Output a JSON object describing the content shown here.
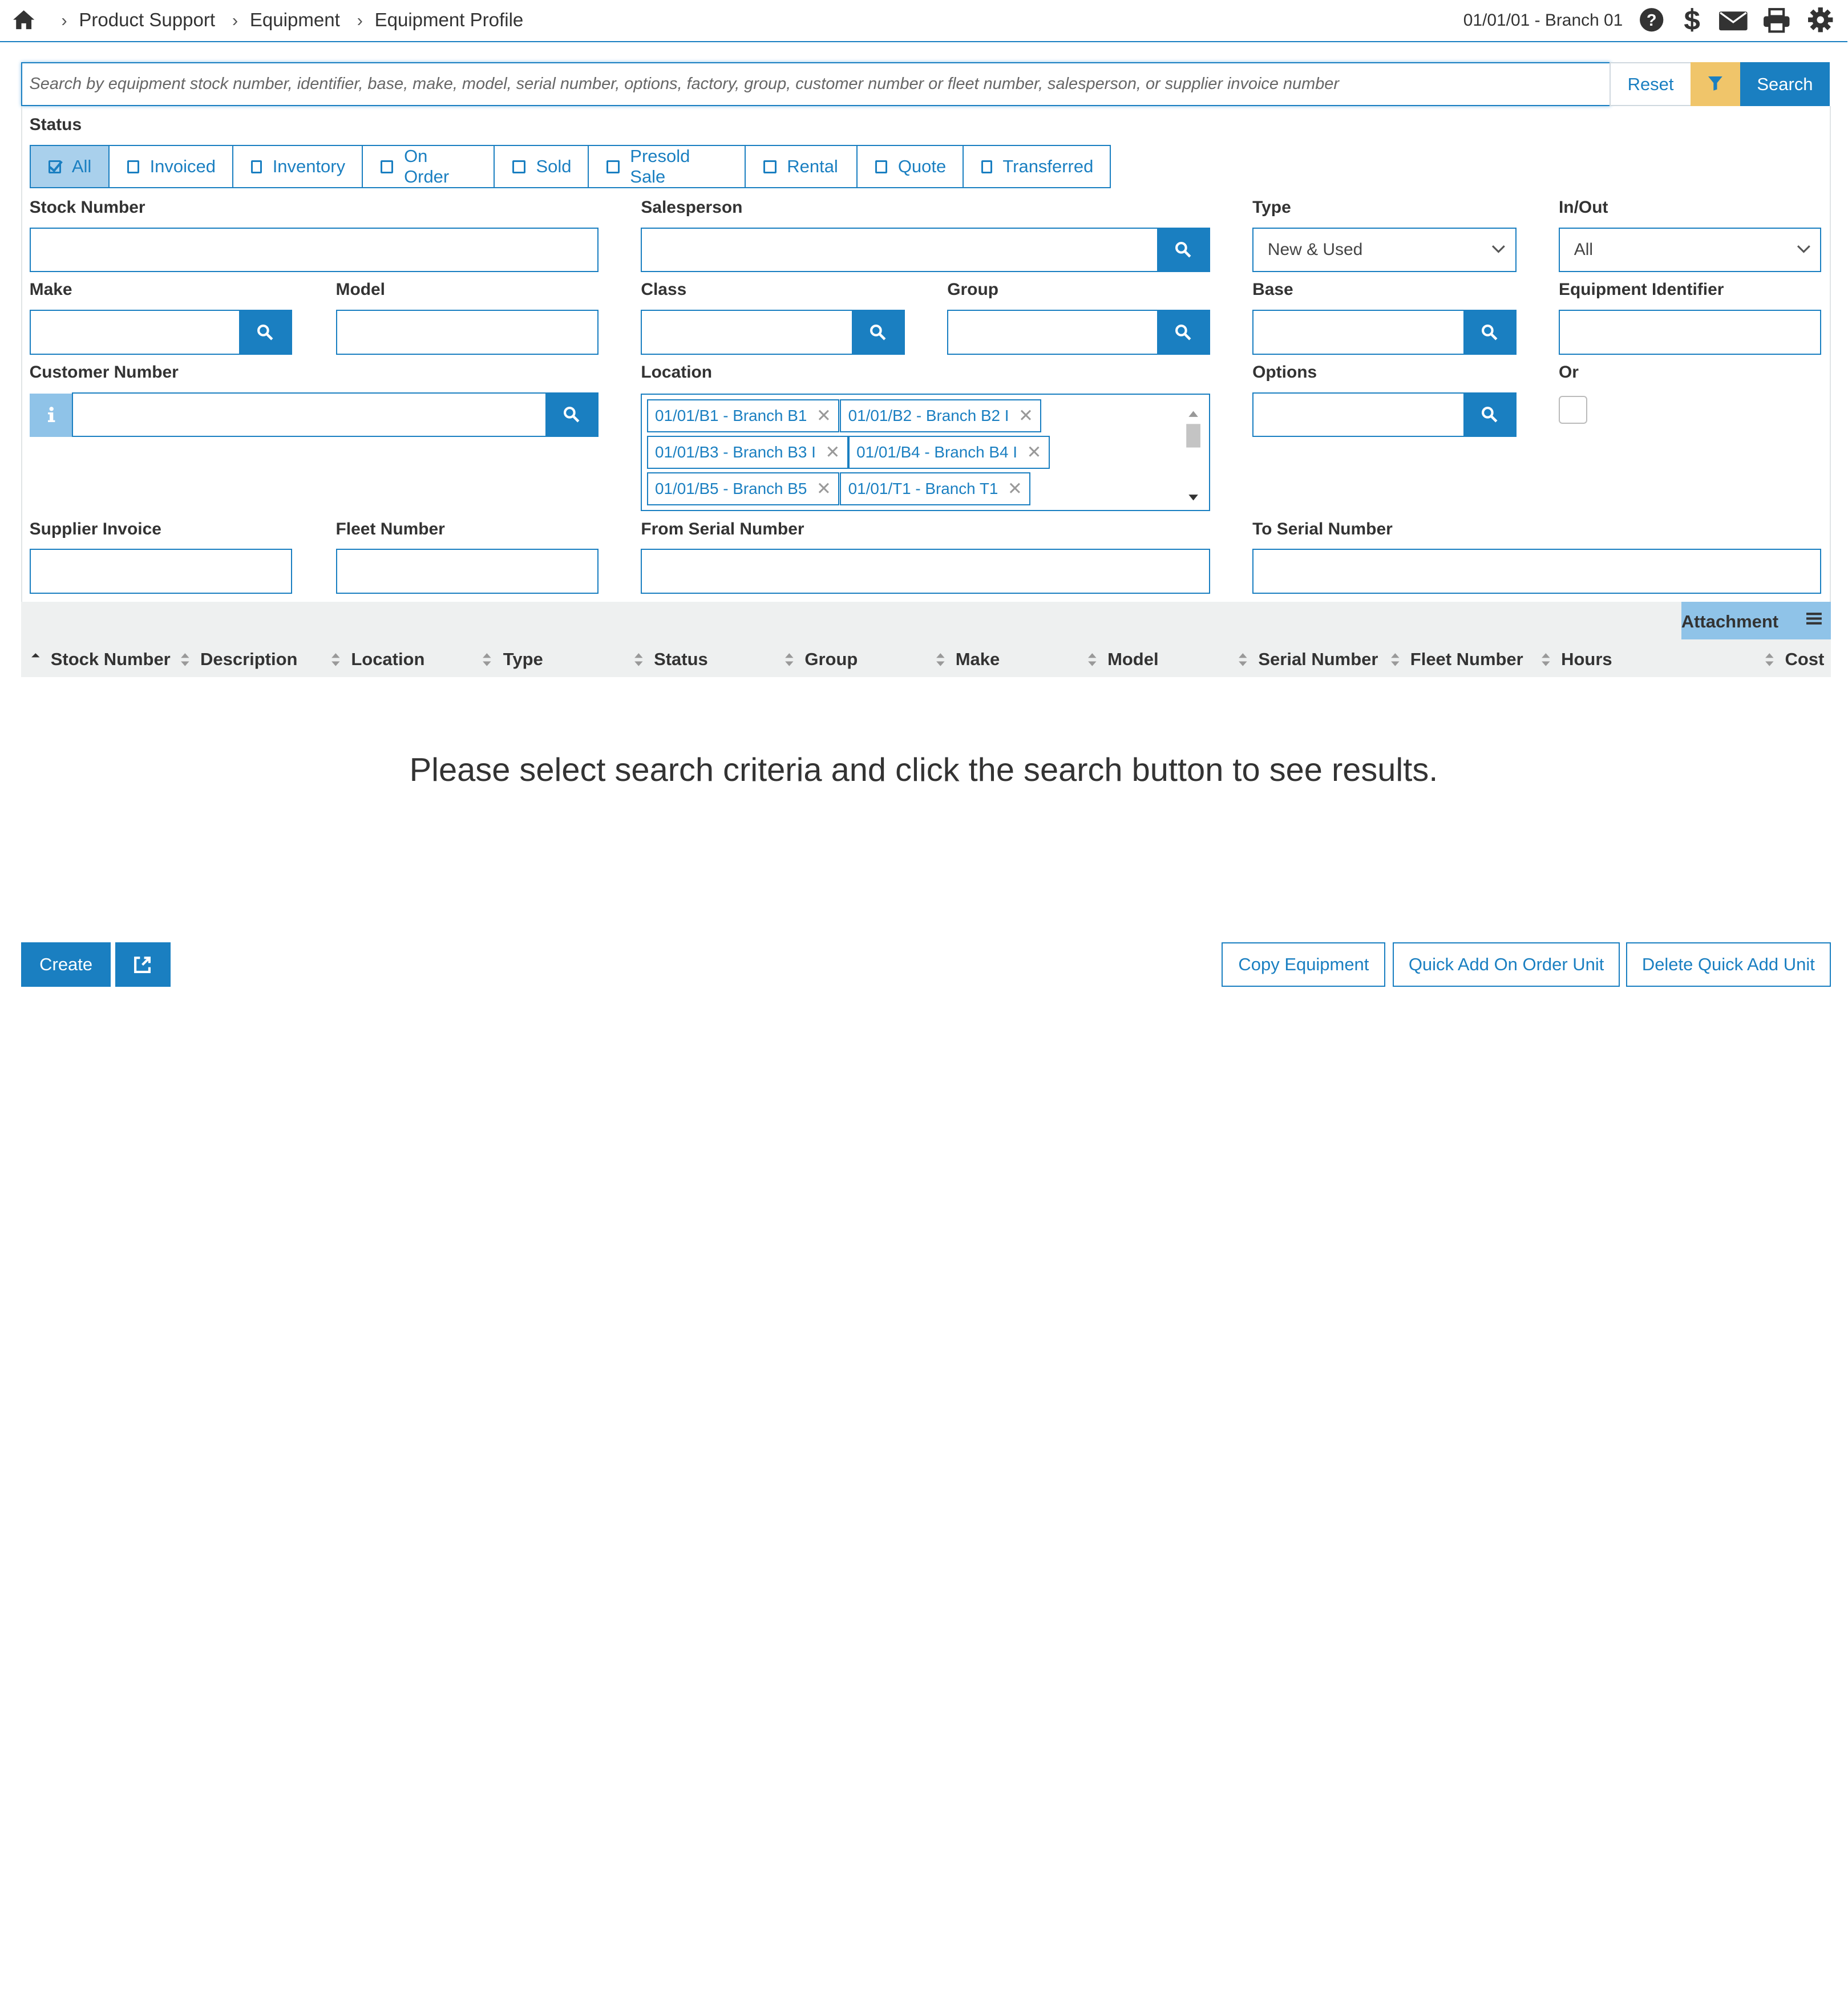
{
  "breadcrumb": [
    "Product Support",
    "Equipment",
    "Equipment Profile"
  ],
  "header": {
    "branch": "01/01/01 - Branch 01"
  },
  "search": {
    "placeholder": "Search by equipment stock number, identifier, base, make, model, serial number, options, factory, group, customer number or fleet number, salesperson, or supplier invoice number",
    "reset_label": "Reset",
    "search_label": "Search"
  },
  "status": {
    "label": "Status",
    "options": [
      "All",
      "Invoiced",
      "Inventory",
      "On Order",
      "Sold",
      "Presold Sale",
      "Rental",
      "Quote",
      "Transferred"
    ],
    "selected": "All"
  },
  "fields": {
    "stock_number": "Stock Number",
    "salesperson": "Salesperson",
    "type": "Type",
    "type_value": "New & Used",
    "in_out": "In/Out",
    "in_out_value": "All",
    "make": "Make",
    "model": "Model",
    "class": "Class",
    "group": "Group",
    "base": "Base",
    "equipment_identifier": "Equipment Identifier",
    "customer_number": "Customer Number",
    "location": "Location",
    "options": "Options",
    "or": "Or",
    "supplier_invoice": "Supplier Invoice",
    "fleet_number": "Fleet Number",
    "from_serial": "From Serial Number",
    "to_serial": "To Serial Number"
  },
  "location_tags": [
    "01/01/B1 - Branch B1",
    "01/01/B2 - Branch B2 I",
    "01/01/B3 - Branch B3 I",
    "01/01/B4 - Branch B4 I",
    "01/01/B5 - Branch B5",
    "01/01/T1 - Branch T1"
  ],
  "grid": {
    "attachment_label": "Attachment",
    "columns": [
      "Stock Number",
      "Description",
      "Location",
      "Type",
      "Status",
      "Group",
      "Make",
      "Model",
      "Serial Number",
      "Fleet Number",
      "Hours",
      "Cost"
    ],
    "empty_message": "Please select search criteria and click the search button to see results."
  },
  "footer": {
    "create_label": "Create",
    "copy_label": "Copy Equipment",
    "quick_add_label": "Quick Add On Order Unit",
    "delete_quick_label": "Delete Quick Add Unit"
  },
  "colors": {
    "primary": "#1a7fc1",
    "filter": "#f0c56a",
    "active_status": "#a9d0ec",
    "addon": "#8fc3e8"
  }
}
